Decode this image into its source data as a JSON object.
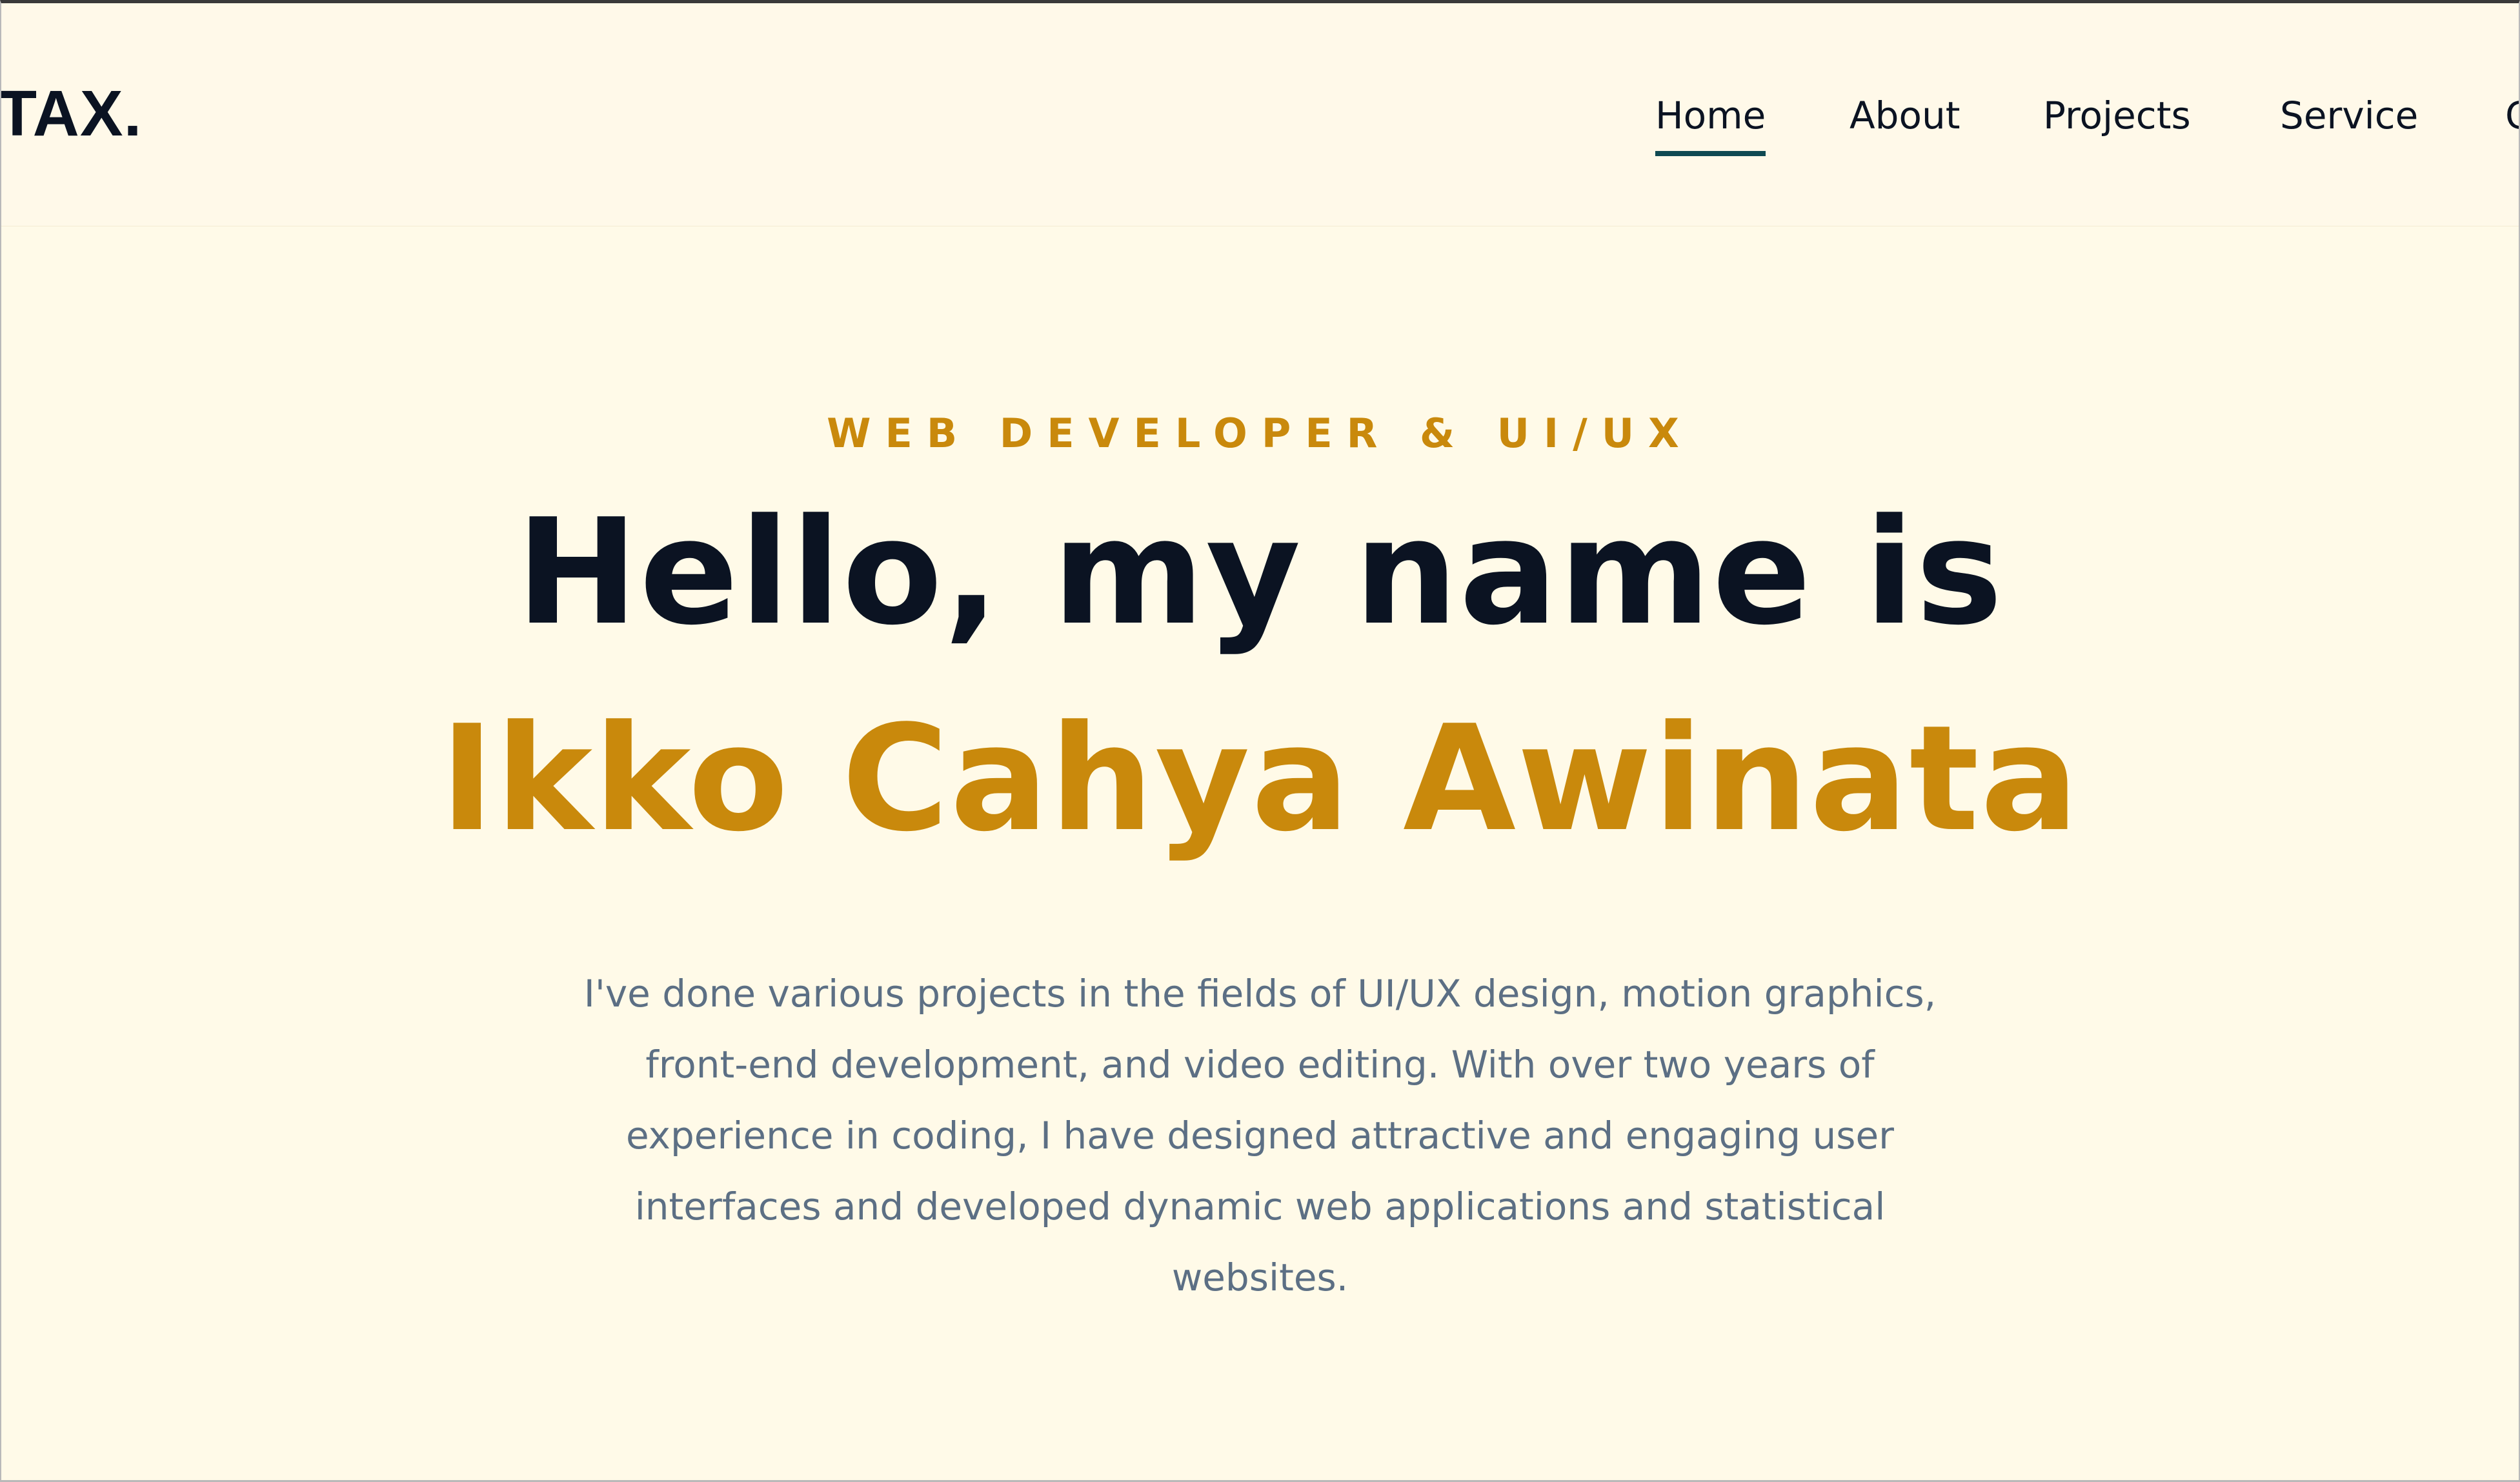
{
  "header": {
    "logo": "TAX.",
    "nav": [
      {
        "label": "Home",
        "active": true
      },
      {
        "label": "About",
        "active": false
      },
      {
        "label": "Projects",
        "active": false
      },
      {
        "label": "Service",
        "active": false
      },
      {
        "label": "C",
        "active": false
      }
    ]
  },
  "hero": {
    "subtitle": "WEB DEVELOPER & UI/UX",
    "headline": "Hello, my name is",
    "name": "Ikko Cahya Awinata",
    "description": "I've done various projects in the fields of UI/UX design, motion graphics, front-end development, and video editing. With over two years of experience in coding, I have designed attractive and engaging user interfaces and developed dynamic web applications and statistical websites."
  },
  "colors": {
    "background": "#fffae8",
    "accent": "#c9890c",
    "text": "#0b1322",
    "muted": "#5c6f84",
    "active_underline": "#0f4a52"
  }
}
